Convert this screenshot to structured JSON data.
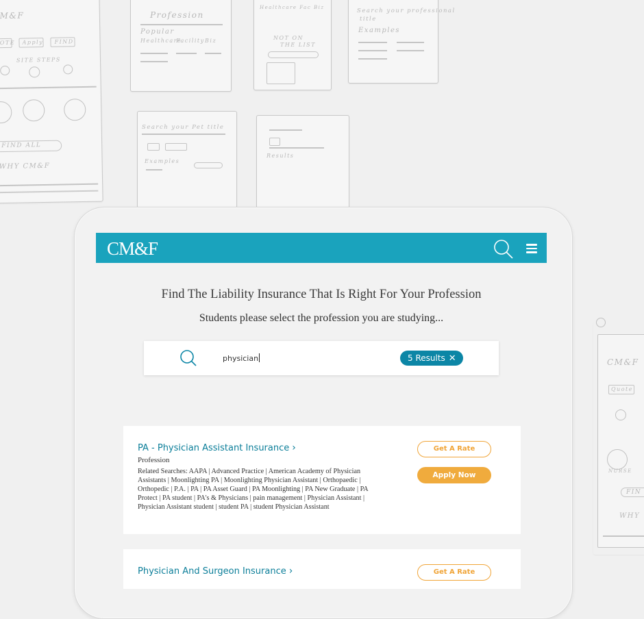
{
  "background_sketches": {
    "s1_logo": "CM&F",
    "s1_btns": [
      "QUOTE",
      "Apply",
      "FIND"
    ],
    "s1_steps": "SITE STEPS",
    "s1_find_all": "FIND ALL",
    "s1_why": "WHY  CM&F",
    "s2_profession": "Profession",
    "s2_popular": "Popular",
    "s2_items": [
      "Healthcare",
      "Facility",
      "Biz"
    ],
    "s3_header": "Healthcare  Fac  Biz",
    "s3_not": "NOT ON",
    "s3_list": "THE LIST",
    "s4_search": "Search your professional title",
    "s4_examples": "Examples",
    "s5_search": "Search your Pet title",
    "s5_examples": "Examples",
    "s6_results": "Results",
    "s7_logo": "CM&F",
    "s7_quote": "Quote",
    "s7_nurse": "NURSE",
    "s7_fin": "FIN",
    "s7_why": "WHY"
  },
  "navbar": {
    "logo": "CM&F",
    "search_icon": "search-icon",
    "menu_icon": "hamburger-menu-icon",
    "color": "#1aa3bd"
  },
  "headline": "Find The Liability Insurance That Is Right For Your Profession",
  "subhead": "Students please select the profession you are studying...",
  "search": {
    "value": "physician",
    "results_label": "5 Results",
    "clear_icon": "close-icon"
  },
  "results": [
    {
      "title": "PA - Physician Assistant Insurance",
      "type": "Profession",
      "related": "Related Searches: AAPA | Advanced Practice | American Academy of Physician Assistants | Moonlighting PA | Moonlighting Physician Assistant | Orthopaedic | Orthopedic | P.A. | PA | PA Asset Guard | PA Moonlighting | PA New Graduate | PA Protect | PA student | PA's & Physicians | pain management | Physician Assistant | Physician Assistant student | student PA | student Physician Assistant",
      "rate_label": "Get A Rate",
      "apply_label": "Apply Now"
    },
    {
      "title": "Physician And Surgeon Insurance",
      "rate_label": "Get A Rate"
    }
  ],
  "colors": {
    "accent": "#1aa3bd",
    "badge": "#0c86a6",
    "orange": "#f0a437",
    "link": "#0b7e99"
  }
}
